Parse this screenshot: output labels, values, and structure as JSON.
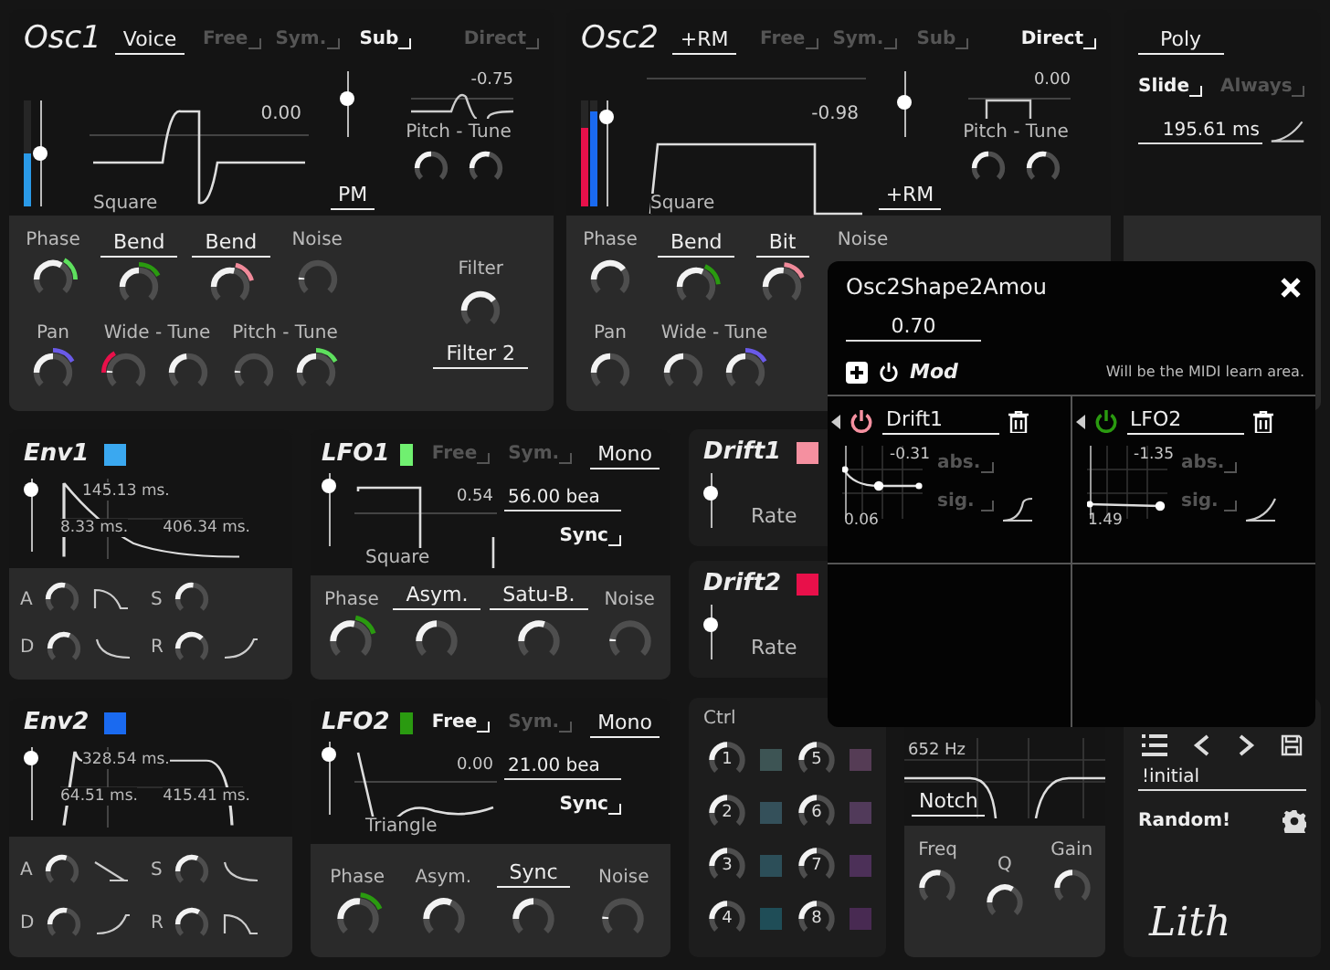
{
  "osc": [
    {
      "title": "Osc1",
      "toggles": [
        {
          "label": "Voice",
          "kind": "select"
        },
        {
          "label": "Free",
          "kind": "check",
          "on": false
        },
        {
          "label": "Sym.",
          "kind": "check",
          "on": false
        },
        {
          "label": "Sub",
          "kind": "check",
          "on": true
        },
        {
          "label": "Direct",
          "kind": "check",
          "on": false
        }
      ],
      "volume": {
        "level": 0.5
      },
      "mod_bars": [
        {
          "color": "#2a9ae8",
          "level": 0.5
        }
      ],
      "wave": {
        "name": "Square",
        "value": "0.00"
      },
      "sub": {
        "level": 0.62,
        "value": "-0.75",
        "mode": "PM"
      },
      "pitch": {
        "label": "Pitch - Tune",
        "knobs": [
          {
            "level": 0.5
          },
          {
            "level": 0.62
          }
        ]
      },
      "rows": [
        [
          {
            "label": "Phase",
            "kind": "text",
            "knobs": [
              {
                "level": 0.75,
                "color": "#5ee05e"
              }
            ]
          },
          {
            "label": "Bend",
            "kind": "select",
            "knobs": [
              {
                "level": 0.5,
                "color": "#2a9a10"
              }
            ]
          },
          {
            "label": "Bend",
            "kind": "select",
            "knobs": [
              {
                "level": 0.62,
                "color": "#f08a9a"
              }
            ]
          },
          {
            "label": "Noise",
            "kind": "text",
            "knobs": [
              {
                "level": 0
              }
            ]
          }
        ],
        [
          {
            "label": "Pan",
            "kind": "text",
            "knobs": [
              {
                "level": 0.5,
                "color": "#6a5ae8"
              }
            ]
          },
          {
            "label": "Wide - Tune",
            "kind": "text",
            "knobs": [
              {
                "level": 0,
                "color": "#e8104a"
              },
              {
                "level": 0.45
              }
            ]
          },
          {
            "label": "Pitch - Tune",
            "kind": "text",
            "knobs": [
              {
                "level": 0
              },
              {
                "level": 0.5,
                "color": "#5ee05e"
              }
            ]
          }
        ]
      ],
      "side": {
        "label": "Filter",
        "knobs": [
          {
            "level": 0.9
          }
        ],
        "select": "Filter 2"
      }
    },
    {
      "title": "Osc2",
      "toggles": [
        {
          "label": "+RM",
          "kind": "select"
        },
        {
          "label": "Free",
          "kind": "check",
          "on": false
        },
        {
          "label": "Sym.",
          "kind": "check",
          "on": false
        },
        {
          "label": "Sub",
          "kind": "check",
          "on": false
        },
        {
          "label": "Direct",
          "kind": "check",
          "on": true
        }
      ],
      "volume": {
        "level": 0.9
      },
      "mod_bars": [
        {
          "color": "#e8104a",
          "level": 0.75
        },
        {
          "color": "#1a6af0",
          "level": 0.9
        }
      ],
      "wave": {
        "name": "Square",
        "value": "-0.98"
      },
      "sub": {
        "level": 0.55,
        "value": "0.00",
        "mode": "+RM"
      },
      "pitch": {
        "label": "Pitch - Tune",
        "knobs": [
          {
            "level": 0.5
          },
          {
            "level": 0.6
          }
        ]
      },
      "rows": [
        [
          {
            "label": "Phase",
            "kind": "text",
            "knobs": [
              {
                "level": 0.9
              }
            ]
          },
          {
            "label": "Bend",
            "kind": "select",
            "knobs": [
              {
                "level": 0.7,
                "color": "#2a9a10"
              }
            ]
          },
          {
            "label": "Bit",
            "kind": "select",
            "knobs": [
              {
                "level": 0.55,
                "color": "#f08a9a"
              }
            ]
          },
          {
            "label": "Noise",
            "kind": "text"
          }
        ],
        [
          {
            "label": "Pan",
            "kind": "text",
            "knobs": [
              {
                "level": 0.5
              }
            ]
          },
          {
            "label": "Wide - Tune",
            "kind": "text",
            "knobs": [
              {
                "level": 0.5
              },
              {
                "level": 0.5,
                "color": "#6a5ae8"
              }
            ]
          }
        ]
      ]
    }
  ],
  "poly": {
    "mode": "Poly",
    "toggles": [
      {
        "label": "Slide",
        "on": true
      },
      {
        "label": "Always",
        "on": false
      }
    ],
    "time": "195.61 ms"
  },
  "envs": [
    {
      "title": "Env1",
      "color": "#3aa8f0",
      "level": 0.95,
      "times": [
        "145.13 ms.",
        "8.33 ms.",
        "406.34 ms."
      ],
      "knobs": [
        {
          "label": "A",
          "level": 0.6
        },
        {
          "label": "S",
          "level": 0.55
        },
        {
          "label": "D",
          "level": 0.7
        },
        {
          "label": "R",
          "level": 0.85
        }
      ]
    },
    {
      "title": "Env2",
      "color": "#1a6af0",
      "level": 0.95,
      "times": [
        "328.54 ms.",
        "64.51 ms.",
        "415.41 ms."
      ],
      "knobs": [
        {
          "label": "A",
          "level": 0.65
        },
        {
          "label": "S",
          "level": 0.7
        },
        {
          "label": "D",
          "level": 0.6
        },
        {
          "label": "R",
          "level": 0.75
        }
      ]
    }
  ],
  "lfos": [
    {
      "title": "LFO1",
      "color": "#70f070",
      "toggles": [
        {
          "label": "Free",
          "kind": "check",
          "on": false
        },
        {
          "label": "Sym.",
          "kind": "check",
          "on": false
        },
        {
          "label": "Mono",
          "kind": "select"
        }
      ],
      "level": 0.9,
      "wave": {
        "name": "Square",
        "value": "0.54"
      },
      "rate": "56.00 bea",
      "sync": {
        "label": "Sync",
        "on": true
      },
      "knobs": [
        {
          "label": "Phase",
          "kind": "text",
          "level": 0.6,
          "color": "#2a9a10"
        },
        {
          "label": "Asym.",
          "kind": "select",
          "level": 0.5
        },
        {
          "label": "Satu-B.",
          "kind": "select",
          "level": 0.65
        },
        {
          "label": "Noise",
          "kind": "text",
          "level": 0
        }
      ]
    },
    {
      "title": "LFO2",
      "color": "#2a9a10",
      "toggles": [
        {
          "label": "Free",
          "kind": "check",
          "on": true
        },
        {
          "label": "Sym.",
          "kind": "check",
          "on": false
        },
        {
          "label": "Mono",
          "kind": "select"
        }
      ],
      "level": 0.9,
      "wave": {
        "name": "Triangle",
        "value": "0.00"
      },
      "rate": "21.00 bea",
      "sync": {
        "label": "Sync",
        "on": true
      },
      "knobs": [
        {
          "label": "Phase",
          "kind": "text",
          "level": 0.55,
          "color": "#2a9a10"
        },
        {
          "label": "Asym.",
          "kind": "text",
          "level": 0.7
        },
        {
          "label": "Sync",
          "kind": "select",
          "level": 0.5
        },
        {
          "label": "Noise",
          "kind": "text",
          "level": 0
        }
      ]
    }
  ],
  "drifts": [
    {
      "title": "Drift1",
      "color": "#f590a0",
      "level": 0.7,
      "label": "Rate"
    },
    {
      "title": "Drift2",
      "color": "#e8104a",
      "level": 0.7,
      "label": "Rate"
    }
  ],
  "ctrl": {
    "title": "Ctrl",
    "items": [
      {
        "label": "1",
        "level": 0.5,
        "color": "#3d5454"
      },
      {
        "label": "5",
        "level": 0.5,
        "color": "#553c55"
      },
      {
        "label": "2",
        "level": 0.5,
        "color": "#34505a"
      },
      {
        "label": "6",
        "level": 0.5,
        "color": "#513a5a"
      },
      {
        "label": "3",
        "level": 0.5,
        "color": "#2c4e58"
      },
      {
        "label": "7",
        "level": 0.5,
        "color": "#4c3058"
      },
      {
        "label": "4",
        "level": 0.5,
        "color": "#1f4d57"
      },
      {
        "label": "8",
        "level": 0.5,
        "color": "#482a52"
      }
    ]
  },
  "filter": {
    "freq": "652 Hz",
    "mode": "Notch",
    "knobs": [
      {
        "label": "Freq",
        "level": 0.6
      },
      {
        "label": "Q",
        "level": 0.75
      },
      {
        "label": "Gain",
        "level": 0.5
      }
    ]
  },
  "preset": {
    "name": "!initial",
    "random": "Random!",
    "logo": "Lith"
  },
  "popup": {
    "title": "Osc2Shape2Amou",
    "value": "0.70",
    "mod_label": "Mod",
    "hint": "Will be the MIDI learn area.",
    "slots": [
      {
        "source": "Drift1",
        "color": "#f590a0",
        "max": "-0.31",
        "min": "0.06",
        "toggles": [
          {
            "label": "abs.",
            "on": false
          },
          {
            "label": "sig.",
            "on": false
          }
        ]
      },
      {
        "source": "LFO2",
        "color": "#2a9a10",
        "max": "-1.35",
        "min": "1.49",
        "toggles": [
          {
            "label": "abs.",
            "on": false
          },
          {
            "label": "sig.",
            "on": false
          }
        ]
      }
    ]
  }
}
